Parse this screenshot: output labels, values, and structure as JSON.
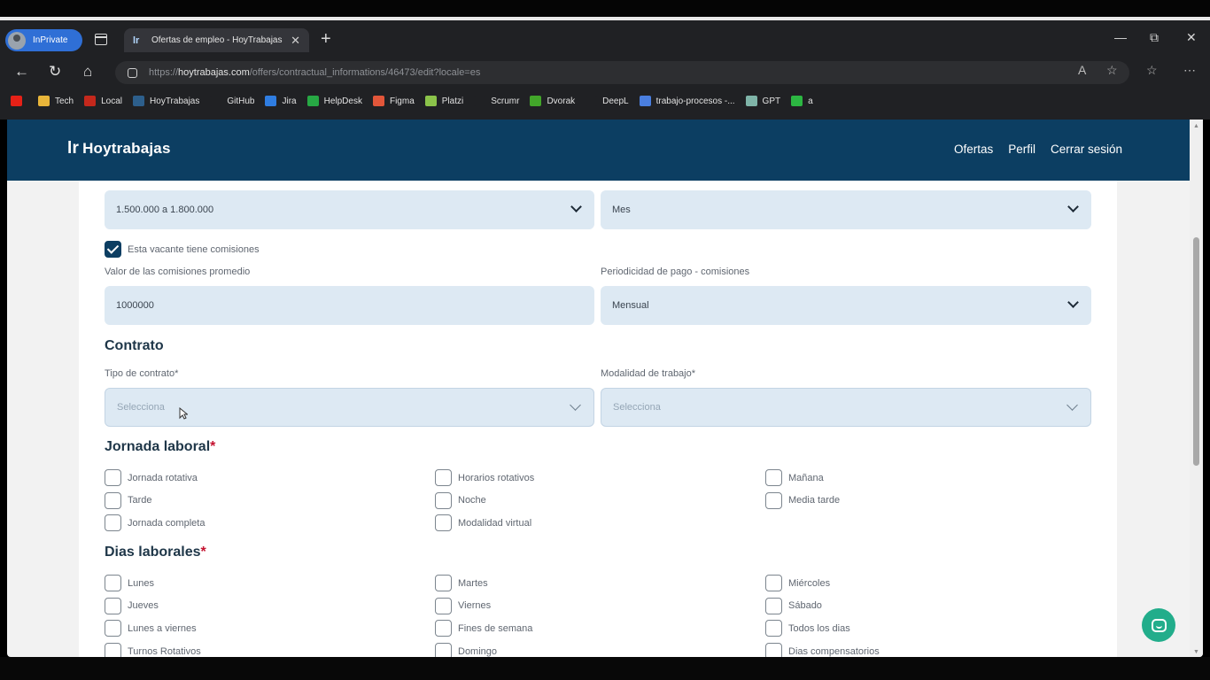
{
  "browser": {
    "inprivate_label": "InPrivate",
    "tab_title": "Ofertas de empleo - HoyTrabajas",
    "tab_favicon": "lr",
    "url_prefix": "https://",
    "url_domain": "hoytrabajas.com",
    "url_path": "/offers/contractual_informations/46473/edit?locale=es",
    "bookmarks": [
      {
        "label": "",
        "icon": "youtube-icon",
        "color": "#e62117"
      },
      {
        "label": "Tech",
        "icon": "folder-icon",
        "color": "#e8b53a"
      },
      {
        "label": "Local",
        "icon": "local-icon",
        "color": "#c4281c"
      },
      {
        "label": "HoyTrabajas",
        "icon": "hoytrabajas-icon",
        "color": "#2d5f8c"
      },
      {
        "label": "GitHub",
        "icon": "github-icon",
        "color": "#202124"
      },
      {
        "label": "Jira",
        "icon": "jira-icon",
        "color": "#2f7de1"
      },
      {
        "label": "HelpDesk",
        "icon": "helpdesk-icon",
        "color": "#27a844"
      },
      {
        "label": "Figma",
        "icon": "figma-icon",
        "color": "#e2563a"
      },
      {
        "label": "Platzi",
        "icon": "platzi-icon",
        "color": "#8bc34a"
      },
      {
        "label": "Scrumr",
        "icon": "page-icon",
        "color": "#202124"
      },
      {
        "label": "Dvorak",
        "icon": "dvorak-icon",
        "color": "#42a62a"
      },
      {
        "label": "DeepL",
        "icon": "deepl-icon",
        "color": "#202124"
      },
      {
        "label": "trabajo-procesos -...",
        "icon": "docs-icon",
        "color": "#4a7fe0"
      },
      {
        "label": "GPT",
        "icon": "gpt-icon",
        "color": "#7fb4a8"
      },
      {
        "label": "a",
        "icon": "whatsapp-icon",
        "color": "#2cb742"
      }
    ]
  },
  "site": {
    "logo_mark": "lr",
    "logo_text": "Hoytrabajas",
    "nav": [
      "Ofertas",
      "Perfil",
      "Cerrar sesión"
    ]
  },
  "form": {
    "salary_value": "1.500.000 a 1.800.000",
    "salary_period_value": "Mes",
    "commission_checkbox_label": "Esta vacante tiene comisiones",
    "commission_checked": true,
    "commission_value_label": "Valor de las comisiones promedio",
    "commission_value": "1000000",
    "commission_period_label": "Periodicidad de pago - comisiones",
    "commission_period_value": "Mensual",
    "contract_title": "Contrato",
    "contract_type_label": "Tipo de contrato*",
    "contract_type_placeholder": "Selecciona",
    "work_mode_label": "Modalidad de trabajo*",
    "work_mode_placeholder": "Selecciona",
    "shift_title": "Jornada laboral",
    "shift_options": [
      [
        "Jornada rotativa",
        "Horarios rotativos",
        "Mañana"
      ],
      [
        "Tarde",
        "Noche",
        "Media tarde"
      ],
      [
        "Jornada completa",
        "Modalidad virtual",
        ""
      ]
    ],
    "days_title": "Dias laborales",
    "days_options": [
      [
        "Lunes",
        "Martes",
        "Miércoles"
      ],
      [
        "Jueves",
        "Viernes",
        "Sábado"
      ],
      [
        "Lunes a viernes",
        "Fines de semana",
        "Todos los dias"
      ],
      [
        "Turnos Rotativos",
        "Domingo",
        "Dias compensatorios"
      ]
    ],
    "required_mark": "*"
  }
}
